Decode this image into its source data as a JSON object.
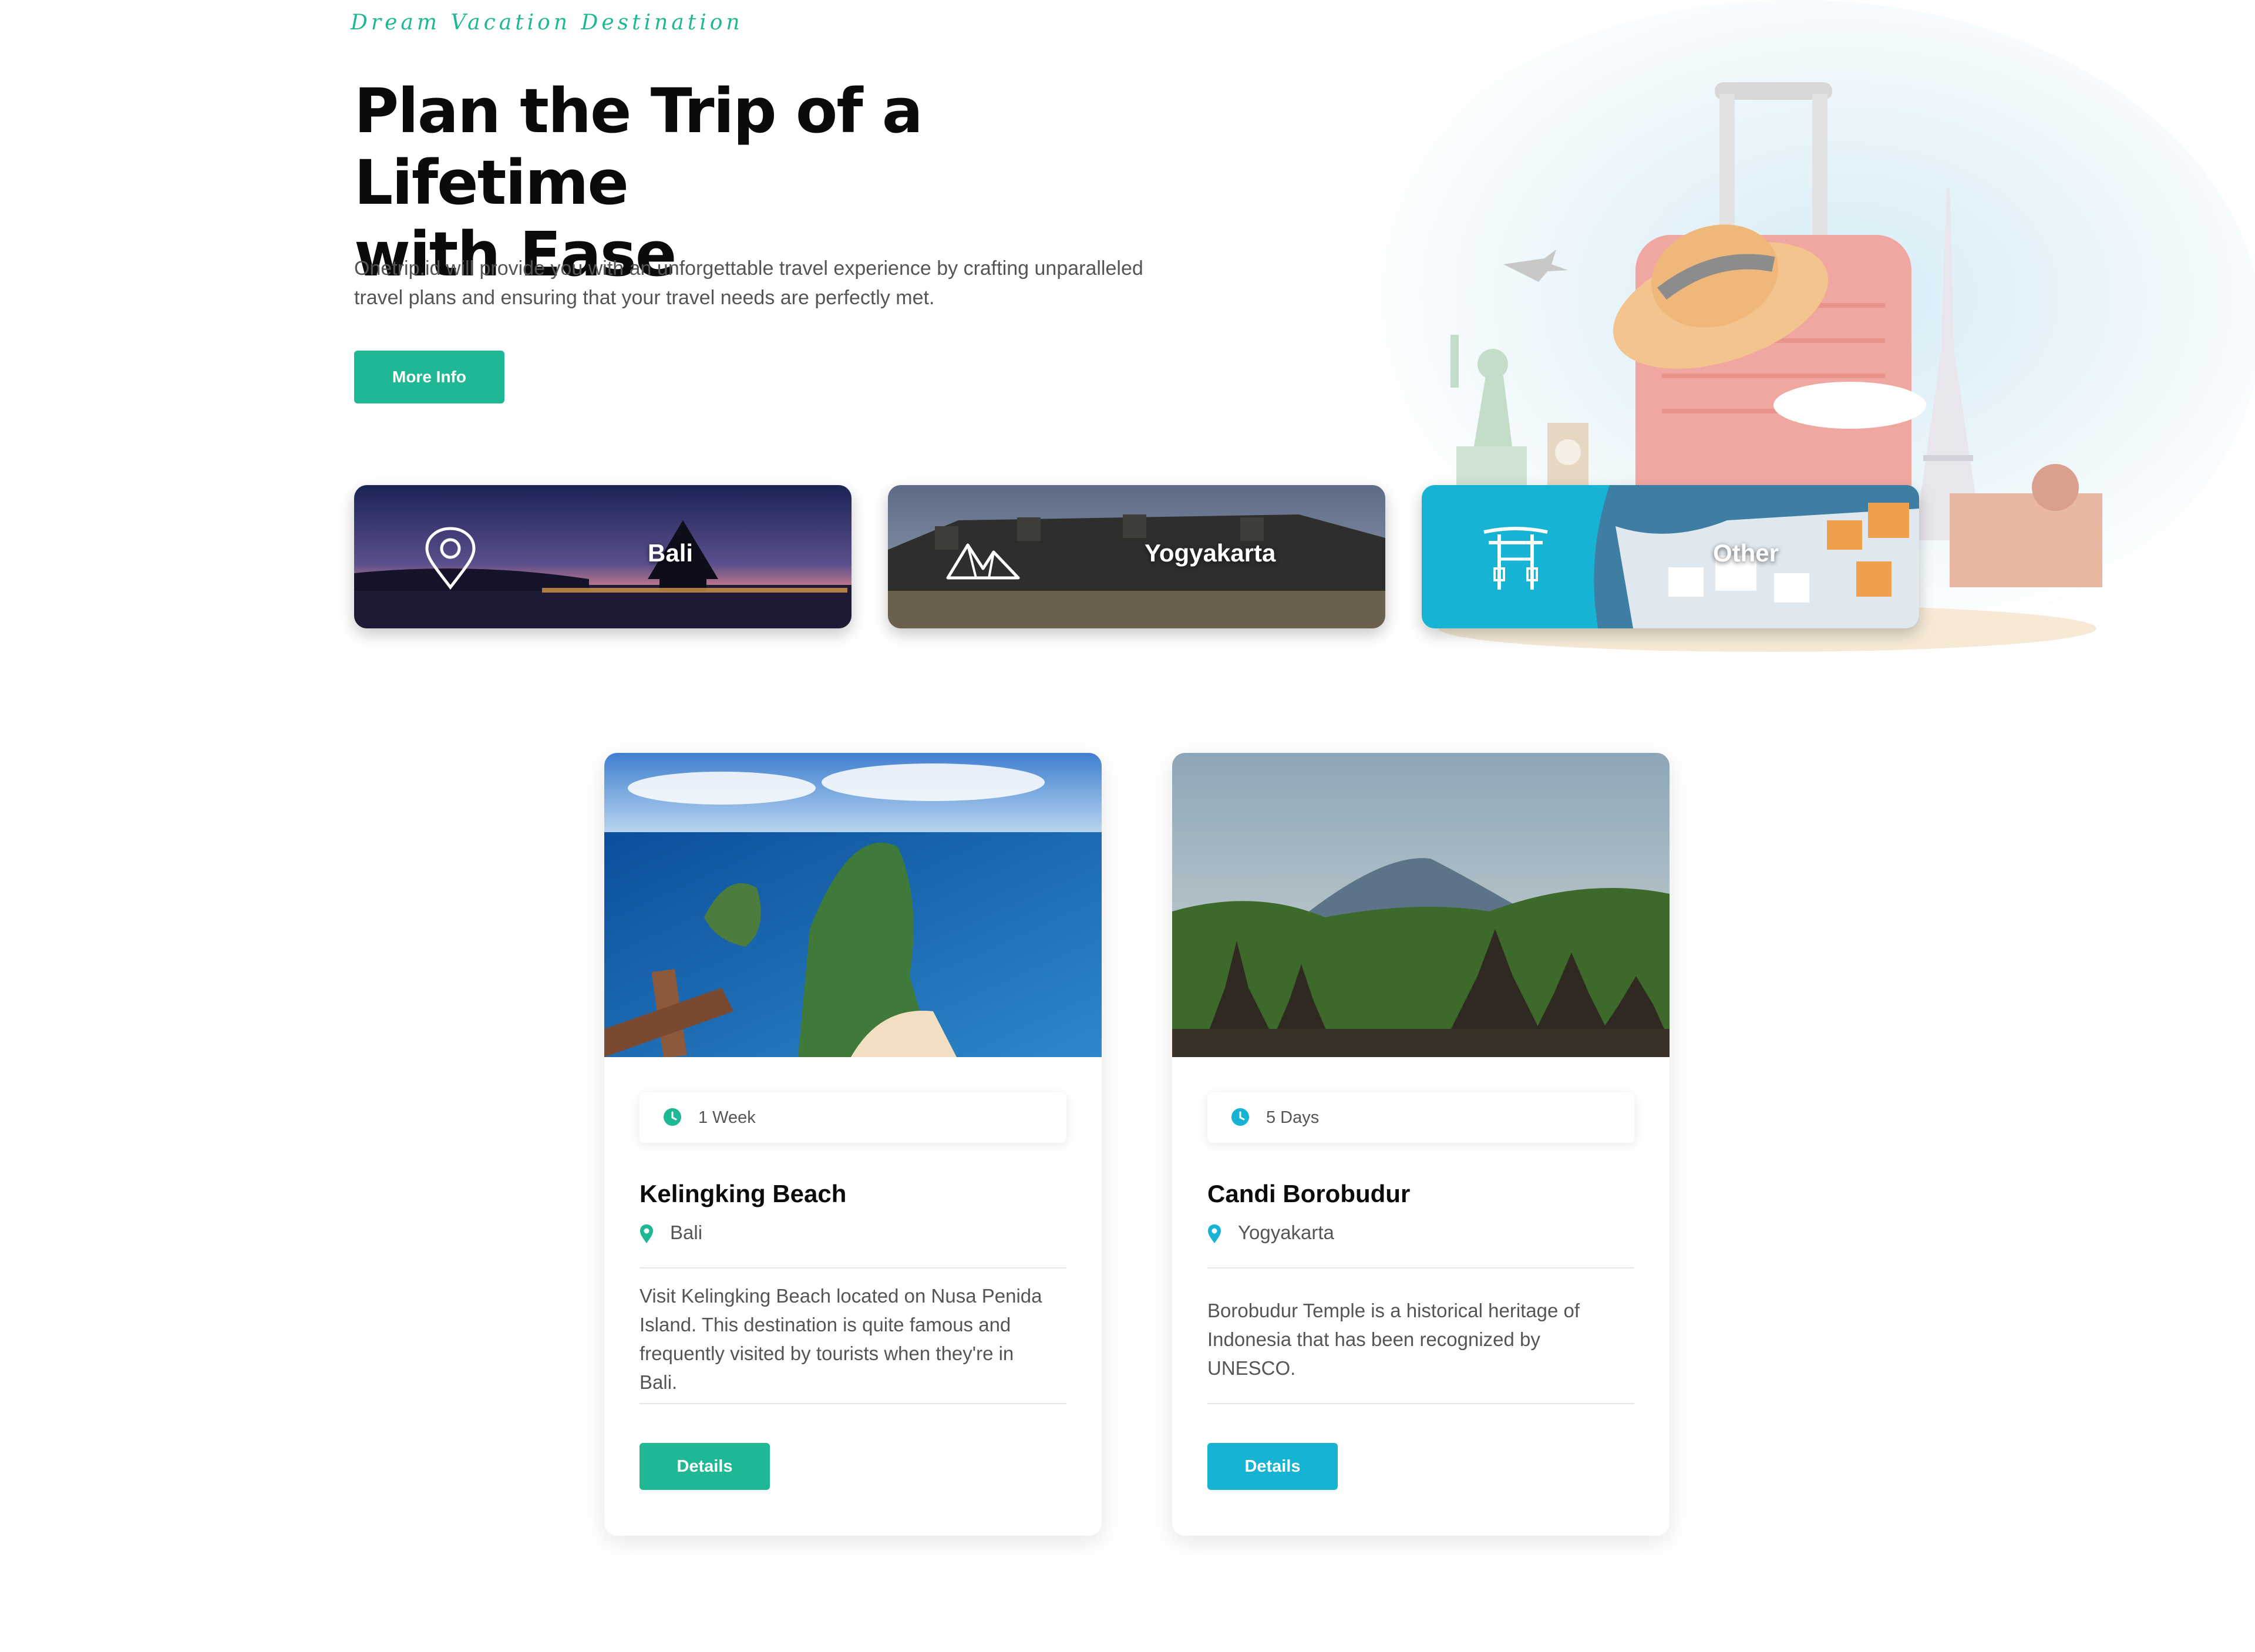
{
  "hero": {
    "tagline": "Dream Vacation Destination",
    "title_line1": "Plan the Trip of a Lifetime",
    "title_line2": "with Ease",
    "description": "Onetrip.id will provide you with an unforgettable travel experience by crafting unparalleled travel plans and ensuring that your travel needs are perfectly met.",
    "more_button": "More Info",
    "illustration_icon": "travel-collage-icon"
  },
  "categories": [
    {
      "label": "Bali",
      "icon": "location-pin-icon"
    },
    {
      "label": "Yogyakarta",
      "icon": "mountain-icon"
    },
    {
      "label": "Other",
      "icon": "torii-gate-icon"
    }
  ],
  "destinations": [
    {
      "duration": "1 Week",
      "name": "Kelingking Beach",
      "location": "Bali",
      "description": "Visit Kelingking Beach located on Nusa Penida Island. This destination is quite famous and frequently visited by tourists when they're in Bali.",
      "button": "Details",
      "accent": "#1fb894"
    },
    {
      "duration": "5 Days",
      "name": "Candi Borobudur",
      "location": "Yogyakarta",
      "description": "Borobudur Temple is a historical heritage of Indonesia that has been recognized by UNESCO.",
      "button": "Details",
      "accent": "#17b3d4"
    }
  ],
  "colors": {
    "primary": "#1fb894",
    "secondary": "#17b3d4",
    "other_card": "#17b3d4"
  }
}
